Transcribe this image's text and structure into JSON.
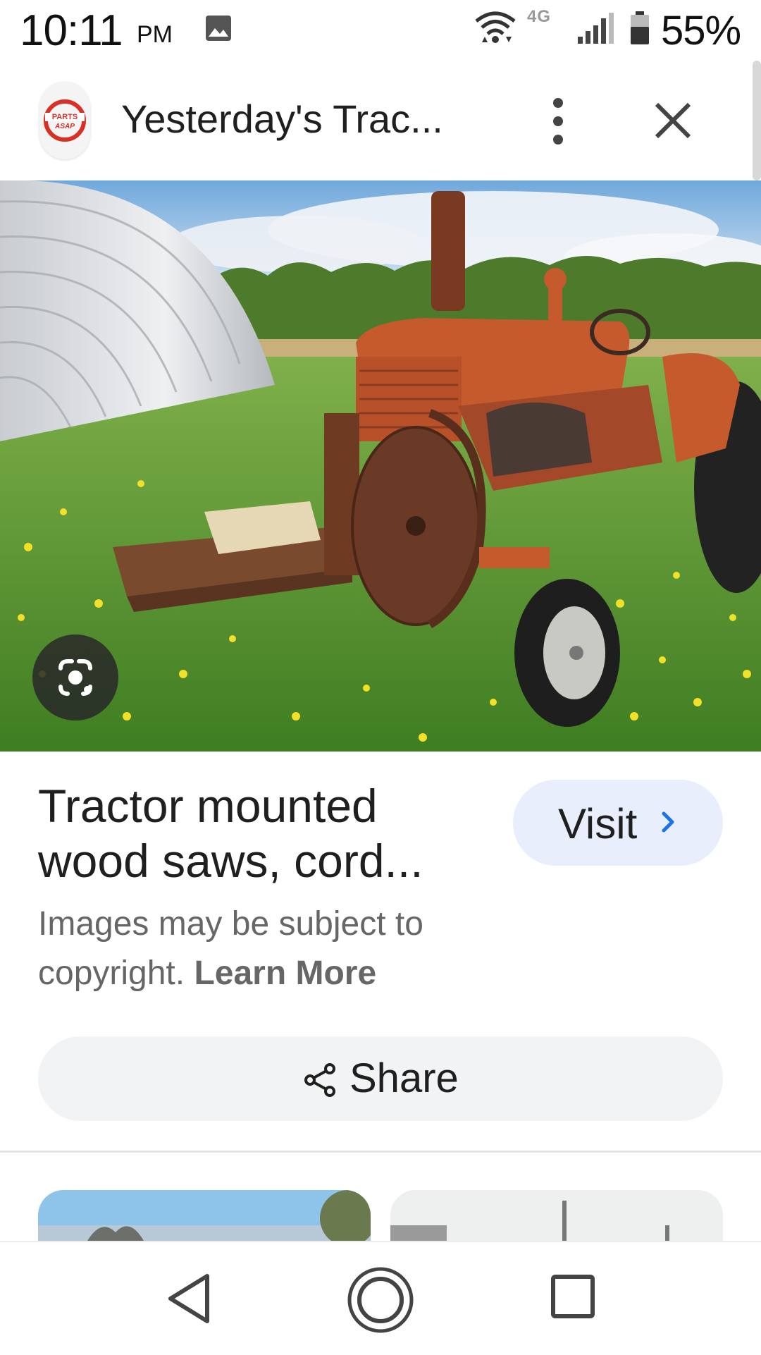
{
  "status_bar": {
    "time": "10:11",
    "ampm": "PM",
    "network": "4G",
    "battery": "55%",
    "icons": [
      "gallery-icon",
      "wifi-icon",
      "signal-icon",
      "battery-icon"
    ]
  },
  "header": {
    "logo_icon": "parts-asap-logo",
    "logo_text_top": "PARTS",
    "logo_text_bottom": "ASAP",
    "title": "Yesterday's Trac...",
    "more_icon": "more-vert-icon",
    "close_icon": "close-icon"
  },
  "image": {
    "lens_icon": "google-lens-icon"
  },
  "result": {
    "title_line1": "Tractor mounted",
    "title_line2": "wood saws, cord...",
    "visit_label": "Visit",
    "copyright_text": "Images may be subject to copyright.",
    "learn_more": "Learn More",
    "share_label": "Share"
  },
  "nav": {
    "icons": [
      "back-icon",
      "home-icon",
      "recents-icon"
    ]
  },
  "colors": {
    "visit_bg": "#e8eefb",
    "visit_chevron": "#1a73e8",
    "share_bg": "#f1f3f4",
    "logo_red": "#d93025"
  }
}
